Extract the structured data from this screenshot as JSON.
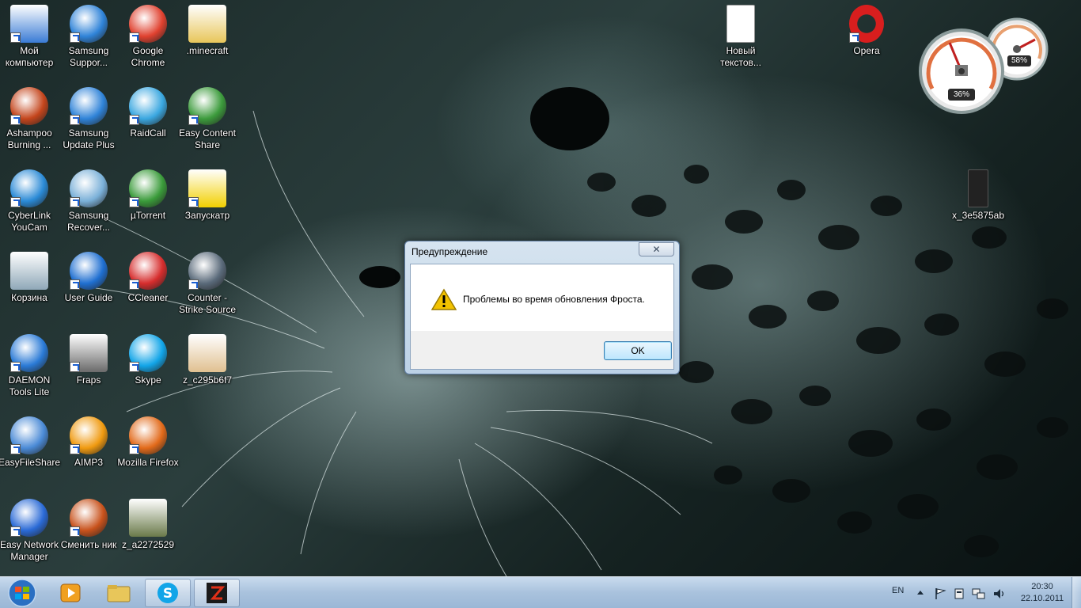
{
  "desktop": {
    "icons": [
      {
        "label": "Мой компьютер",
        "icon": "computer-icon",
        "color": "#3a7bd5"
      },
      {
        "label": "Samsung Suppor...",
        "icon": "samsung-support-icon",
        "color": "#2f83d8"
      },
      {
        "label": "Google Chrome",
        "icon": "chrome-icon",
        "color": "#e0412f"
      },
      {
        "label": ".minecraft",
        "icon": "folder-icon",
        "color": "#e8c65a"
      },
      {
        "label": "Ashampoo Burning ...",
        "icon": "ashampoo-icon",
        "color": "#c4451c"
      },
      {
        "label": "Samsung Update Plus",
        "icon": "samsung-update-icon",
        "color": "#2f83d8"
      },
      {
        "label": "RaidCall",
        "icon": "raidcall-icon",
        "color": "#3aa7e0"
      },
      {
        "label": "Easy Content Share",
        "icon": "easy-content-share-icon",
        "color": "#3c9b3c"
      },
      {
        "label": "CyberLink YouCam",
        "icon": "youcam-icon",
        "color": "#2a8ad6"
      },
      {
        "label": "Samsung Recover...",
        "icon": "samsung-recovery-icon",
        "color": "#7ab0d8"
      },
      {
        "label": "µTorrent",
        "icon": "utorrent-icon",
        "color": "#3a9b3a"
      },
      {
        "label": "Запускатр",
        "icon": "launcher-icon",
        "color": "#f2d000"
      },
      {
        "label": "Корзина",
        "icon": "recycle-bin-icon",
        "color": "#8fa8b8"
      },
      {
        "label": "User Guide",
        "icon": "user-guide-icon",
        "color": "#1f6fd1"
      },
      {
        "label": "CCleaner",
        "icon": "ccleaner-icon",
        "color": "#d62d2d"
      },
      {
        "label": "Counter - Strike Source",
        "icon": "counter-strike-icon",
        "color": "#5a6a7a"
      },
      {
        "label": "DAEMON Tools Lite",
        "icon": "daemon-tools-icon",
        "color": "#2a7ad6"
      },
      {
        "label": "Fraps",
        "icon": "fraps-icon",
        "color": "#6a6a6a"
      },
      {
        "label": "Skype",
        "icon": "skype-icon",
        "color": "#12a5e8"
      },
      {
        "label": "z_c295b6f7",
        "icon": "image-file-icon",
        "color": "#e0c090"
      },
      {
        "label": "EasyFileShare",
        "icon": "easy-file-share-icon",
        "color": "#4a8ad6"
      },
      {
        "label": "AIMP3",
        "icon": "aimp-icon",
        "color": "#f09a10"
      },
      {
        "label": "Mozilla Firefox",
        "icon": "firefox-icon",
        "color": "#e26a1a"
      },
      {
        "label": "",
        "icon": "empty-slot",
        "color": "#000000"
      },
      {
        "label": "Easy Network Manager",
        "icon": "easy-network-manager-icon",
        "color": "#2a6ad6"
      },
      {
        "label": "Сменить ник",
        "icon": "change-nick-icon",
        "color": "#c8521c"
      },
      {
        "label": "z_a2272529",
        "icon": "image-file-icon",
        "color": "#6a7a4a"
      }
    ],
    "extra_icons": [
      {
        "label": "Новый текстов...",
        "icon": "text-document-icon",
        "color": "#ffffff"
      },
      {
        "label": "Opera",
        "icon": "opera-icon",
        "color": "#d81e1e"
      },
      {
        "label": "x_3e5875ab",
        "icon": "image-file-icon",
        "color": "#222222"
      }
    ]
  },
  "gadget": {
    "cpu": {
      "label": "36%",
      "value": 36
    },
    "memory": {
      "label": "58%",
      "value": 58
    }
  },
  "dialog": {
    "title": "Предупреждение",
    "close_label": "✕",
    "message": "Проблемы во время обновления Фроста.",
    "ok_label": "OK"
  },
  "taskbar": {
    "pinned": [
      {
        "icon": "media-player-icon"
      },
      {
        "icon": "explorer-icon"
      },
      {
        "icon": "skype-icon",
        "active": true
      },
      {
        "icon": "game-app-icon",
        "active": true
      }
    ],
    "language": "EN",
    "clock": {
      "time": "20:30",
      "date": "22.10.2011"
    }
  },
  "colors": {
    "accent": "#3c7fb1",
    "taskbar": "#a9c2dd",
    "warning": "#f2c200"
  }
}
